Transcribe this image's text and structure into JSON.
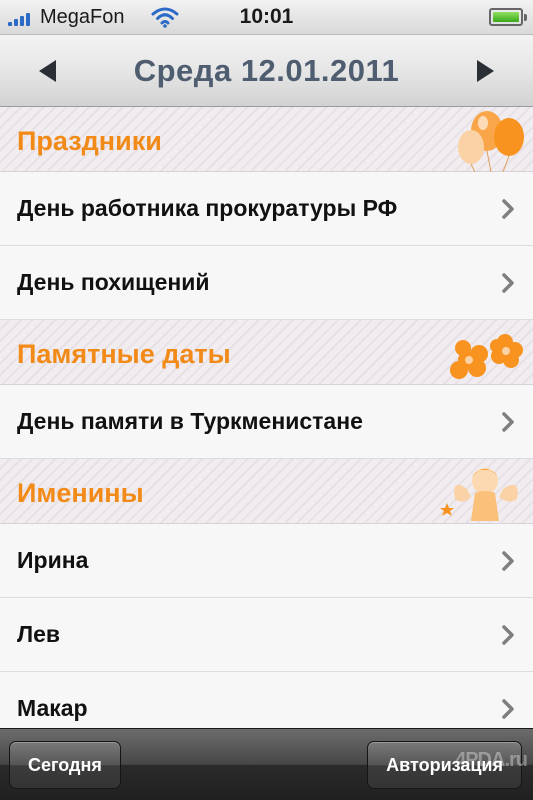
{
  "status_bar": {
    "carrier": "MegaFon",
    "time": "10:01",
    "signal_bars": 4
  },
  "nav": {
    "title": "Среда 12.01.2011",
    "prev_icon": "left-triangle-icon",
    "next_icon": "right-triangle-icon"
  },
  "sections": [
    {
      "title": "Праздники",
      "decoration_icon": "balloons-icon",
      "items": [
        "День работника прокуратуры РФ",
        "День похищений"
      ]
    },
    {
      "title": "Памятные даты",
      "decoration_icon": "flowers-icon",
      "items": [
        "День памяти в Туркменистане"
      ]
    },
    {
      "title": "Именины",
      "decoration_icon": "angel-icon",
      "items": [
        "Ирина",
        "Лев",
        "Макар"
      ]
    }
  ],
  "toolbar": {
    "today_label": "Сегодня",
    "auth_label": "Авторизация",
    "watermark": "4PDA.ru"
  },
  "colors": {
    "section_title": "#f28a17",
    "nav_title": "#4e5d70",
    "chevron": "#7f7f7f",
    "signal": "#2c6ac8"
  }
}
